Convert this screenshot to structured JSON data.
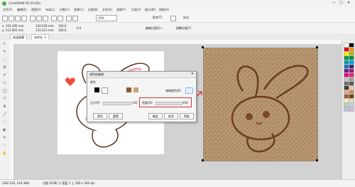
{
  "window": {
    "title": "CorelDRAW X8 (64-Bit)",
    "controls": [
      "—",
      "□",
      "✕"
    ]
  },
  "menubar": {
    "items": [
      "文件(F)",
      "编辑(E)",
      "视图(V)",
      "布局(L)",
      "对象(C)",
      "效果(C)",
      "位图(B)",
      "文本(X)",
      "表格(T)",
      "工具(O)",
      "窗口(W)",
      "帮助(H)"
    ]
  },
  "toolbar": {
    "zoom_value": "10%",
    "snap_label": "贴齐(T)",
    "launch_label": "启动"
  },
  "propertybar": {
    "x_value": "x: 154.395 mm",
    "y_value": "y: 112.495 mm",
    "w_value": "130.536 mm",
    "h_value": "133.313 mm",
    "scale_w": "100.0",
    "scale_h": "100.0",
    "angle": "0.0",
    "mode_label": "编辑位图(E)...",
    "trace_label": "描摹位图(T)"
  },
  "tabs": {
    "welcome": "欢迎屏幕",
    "doc": "未命名 -1"
  },
  "tools": [
    "↖",
    "✎",
    "⬚",
    "Q",
    "✐",
    "▭",
    "◯",
    "⬠",
    "A",
    "╱",
    "⬚",
    "◐",
    "✎",
    "⟋",
    "✋"
  ],
  "dialog": {
    "title": "调色板编辑",
    "section_label": "颜色",
    "sample_label": "笔刷颜色(B)",
    "pressure_label": "压力(P):",
    "pressure_value": "100",
    "density_label": "密度(D):",
    "density_value": "100",
    "preview_button": "预览",
    "reset_button": "重置",
    "ok_button": "确定",
    "cancel_button": "取消",
    "help_button": "帮助"
  },
  "status": {
    "coords": "(282.126, 216.384)",
    "info": "位图 (RGB) 于 图层 1 上 300 x 300 dpi"
  },
  "palette": [
    "#ffffff",
    "#000000",
    "#e30613",
    "#f39200",
    "#ffed00",
    "#95c11f",
    "#009640",
    "#008d36",
    "#00a19a",
    "#009fe3",
    "#1d71b8",
    "#2d2e83",
    "#662483",
    "#951b81",
    "#e6007e",
    "#e71d73",
    "#c4c4c4",
    "#9d9d9c",
    "#706f6f",
    "#575756",
    "#3c3c3b",
    "#f5c1a6",
    "#e8a87c",
    "#c58e5a",
    "#936037",
    "#6b3e1f",
    "#fce6cf",
    "#f9d6a5",
    "#b5d7a8",
    "#a6dcef",
    "#b7c3e6",
    "#d8b6d9"
  ],
  "colors": {
    "accent_red": "#e0302a",
    "sketch_brown": "#7a4a28",
    "sketch_texture": "#b08d68"
  }
}
